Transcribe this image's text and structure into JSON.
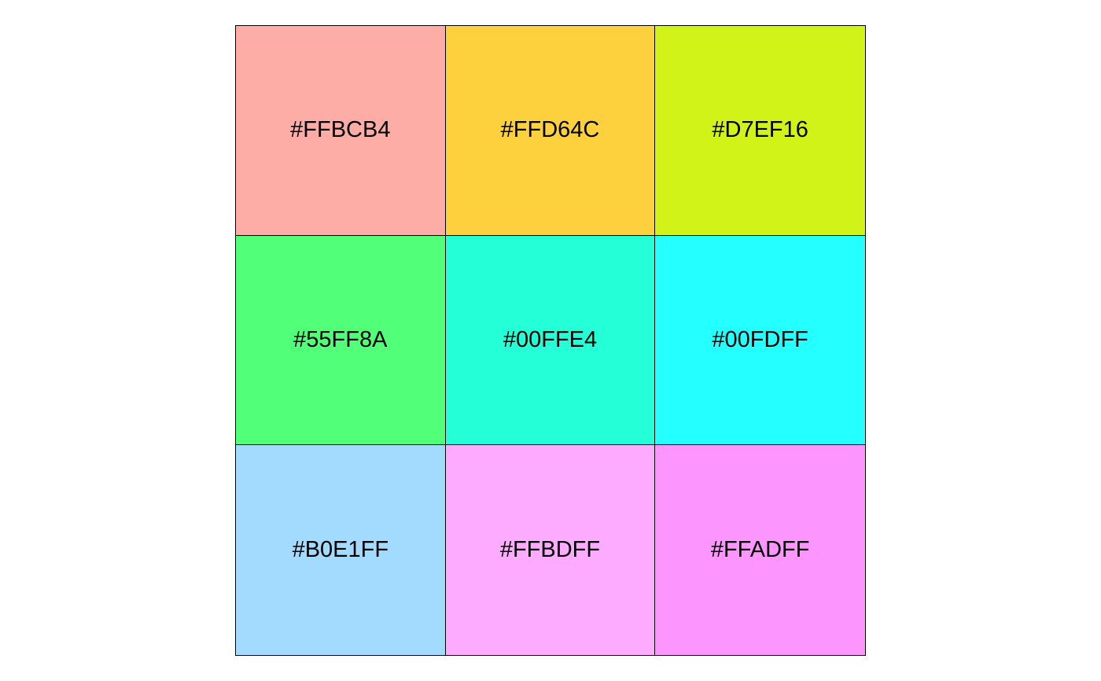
{
  "swatches": [
    {
      "label": "#FFBCB4",
      "fill": "#FDACA6"
    },
    {
      "label": "#FFD64C",
      "fill": "#FDD03D"
    },
    {
      "label": "#D7EF16",
      "fill": "#D1F318"
    },
    {
      "label": "#55FF8A",
      "fill": "#52FF79"
    },
    {
      "label": "#00FFE4",
      "fill": "#24FFD7"
    },
    {
      "label": "#00FDFF",
      "fill": "#24FFFF"
    },
    {
      "label": "#B0E1FF",
      "fill": "#A3DBFF"
    },
    {
      "label": "#FFBDFF",
      "fill": "#FDABFF"
    },
    {
      "label": "#FFADFF",
      "fill": "#FD95FF"
    }
  ]
}
